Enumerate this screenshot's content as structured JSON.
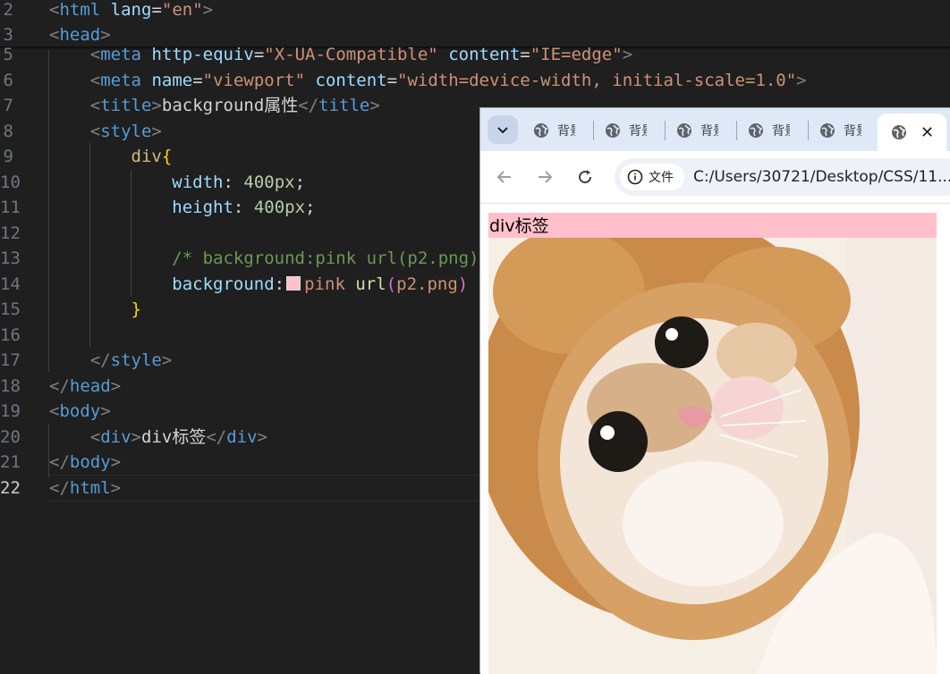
{
  "editor": {
    "line_numbers": [
      "2",
      "3",
      "5",
      "6",
      "7",
      "8",
      "9",
      "10",
      "11",
      "12",
      "13",
      "14",
      "15",
      "16",
      "17",
      "18",
      "19",
      "20",
      "21",
      "22"
    ],
    "active_line": "22",
    "code": {
      "l2": {
        "tag": "html",
        "attr": "lang",
        "val": "\"en\""
      },
      "l3": {
        "tag": "head"
      },
      "l5": {
        "tag": "meta",
        "attr1": "http-equiv",
        "val1": "\"X-UA-Compatible\"",
        "attr2": "content",
        "val2": "\"IE=edge\""
      },
      "l6": {
        "tag": "meta",
        "attr1": "name",
        "val1": "\"viewport\"",
        "attr2": "content",
        "val2": "\"width=device-width, initial-scale=1.0\""
      },
      "l7": {
        "tag": "title",
        "text": "background属性"
      },
      "l8": {
        "tag": "style"
      },
      "l9": {
        "selector": "div",
        "brace": "{"
      },
      "l10": {
        "prop": "width",
        "num": "400px"
      },
      "l11": {
        "prop": "height",
        "num": "400px"
      },
      "l13": {
        "comment": "/* background:pink url(p2.png)"
      },
      "l14": {
        "prop": "background",
        "val": "pink",
        "fn": "url",
        "arg": "p2.png"
      },
      "l15": {
        "brace": "}"
      },
      "l17": {
        "tag": "style"
      },
      "l18": {
        "tag": "head"
      },
      "l19": {
        "tag": "body"
      },
      "l20": {
        "tag": "div",
        "text": "div标签"
      },
      "l21": {
        "tag": "body"
      },
      "l22": {
        "tag": "html"
      }
    },
    "swatch_color": "#ffc0cb"
  },
  "browser": {
    "tabs": [
      {
        "label": "背景"
      },
      {
        "label": "背景"
      },
      {
        "label": "背景"
      },
      {
        "label": "背景"
      },
      {
        "label": "背景"
      }
    ],
    "tab_menu_icon": "chevron-down-icon",
    "close_glyph": "✕",
    "site_info_label": "文件",
    "url": "C:/Users/30721/Desktop/CSS/11....",
    "page": {
      "div_text": "div标签",
      "div_background": "#ffc0cb"
    }
  }
}
